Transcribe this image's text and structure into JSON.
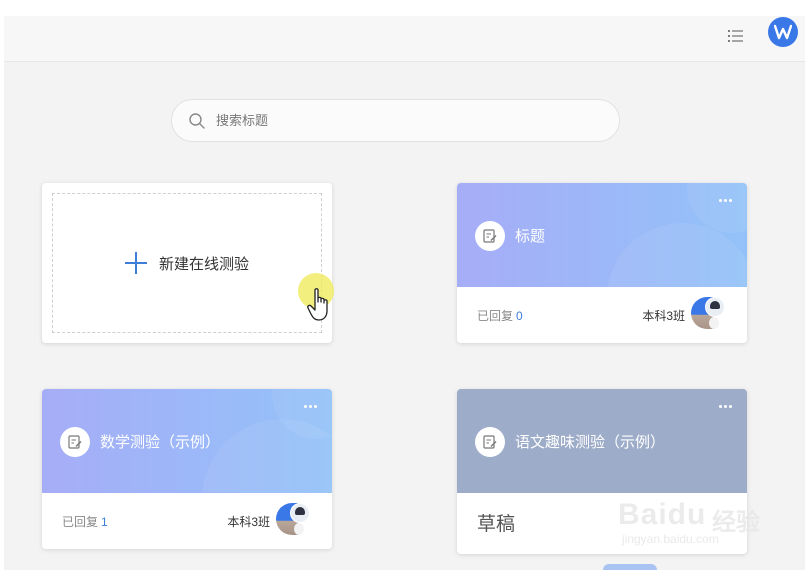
{
  "search": {
    "placeholder": "搜索标题"
  },
  "new_card": {
    "label": "新建在线测验"
  },
  "cards": [
    {
      "title": "标题",
      "reply_label": "已回复",
      "reply_count": "0",
      "class_name": "本科3班",
      "header_style": "blue-gradient"
    },
    {
      "title": "数学测验（示例）",
      "reply_label": "已回复",
      "reply_count": "1",
      "class_name": "本科3班",
      "header_style": "blue-gradient"
    },
    {
      "title": "语文趣味测验（示例）",
      "status": "草稿",
      "header_style": "slate"
    }
  ],
  "watermark": {
    "brand": "Baidu",
    "text": "经验",
    "url": "jingyan.baidu.com"
  },
  "icons": [
    "menu-icon",
    "wps-logo-icon",
    "search-icon",
    "plus-icon",
    "document-edit-icon",
    "more-icon",
    "hand-cursor-icon"
  ],
  "colors": {
    "accent": "#3b78e7",
    "gradient_start": "#a6adf7",
    "gradient_end": "#93c2f8",
    "slate": "#9dacc8",
    "count": "#3e7ed8"
  }
}
